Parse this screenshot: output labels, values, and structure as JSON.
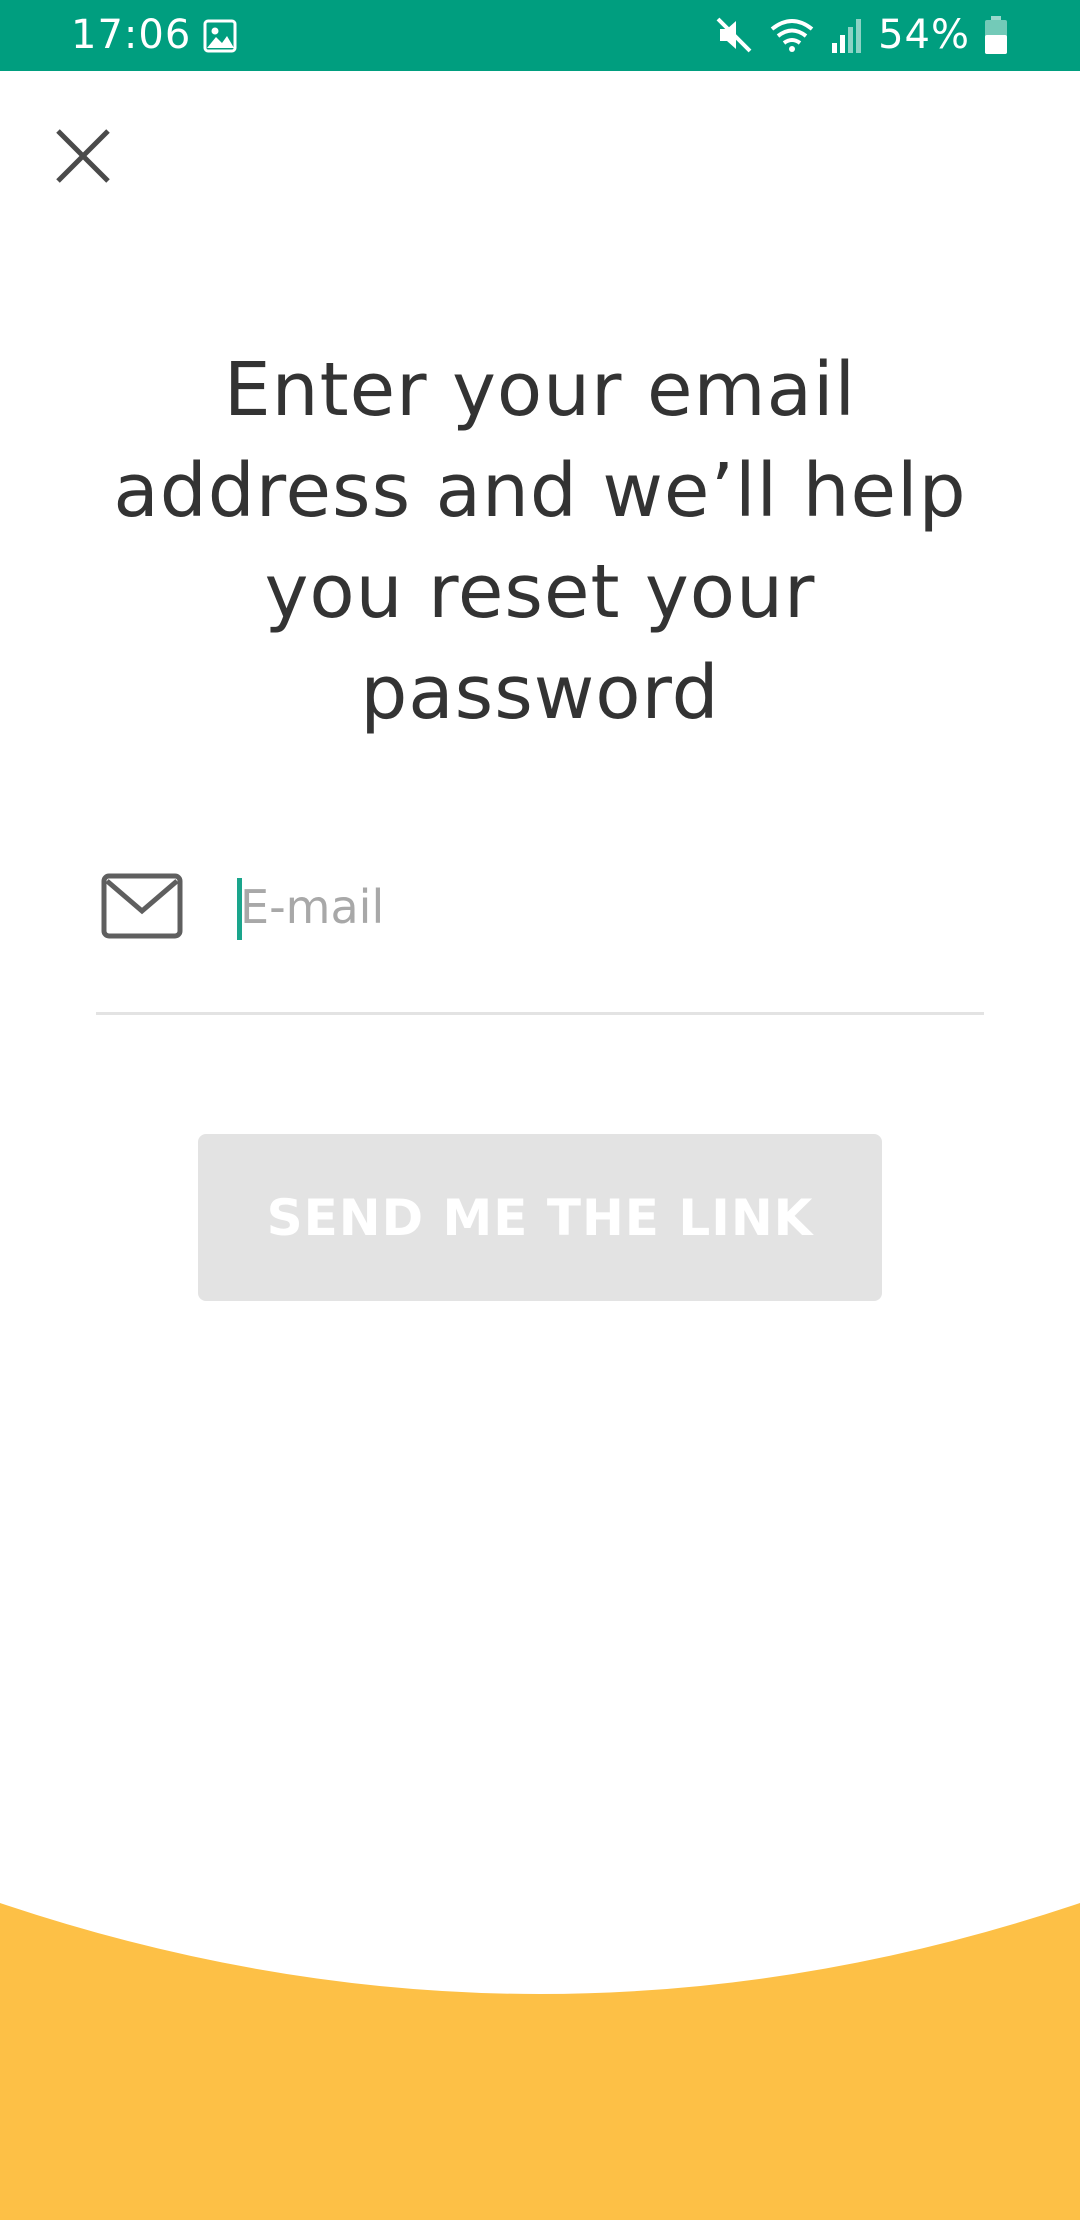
{
  "status_bar": {
    "time": "17:06",
    "battery_percent": "54%",
    "icons": [
      "gallery-icon",
      "mute-icon",
      "wifi-icon",
      "signal-icon",
      "battery-icon"
    ],
    "background_color": "#009e7f"
  },
  "header": {
    "close_icon": "close-icon"
  },
  "main": {
    "headline": "Enter your email address and we’ll help you reset your password",
    "email_field": {
      "icon": "mail-icon",
      "value": "",
      "placeholder": "E-mail"
    },
    "send_button_label": "SEND ME THE LINK",
    "send_button_state": "disabled"
  },
  "colors": {
    "accent": "#1aa58c",
    "footer_wave": "#fdc046",
    "button_disabled": "#e3e3e3",
    "text": "#333333"
  }
}
